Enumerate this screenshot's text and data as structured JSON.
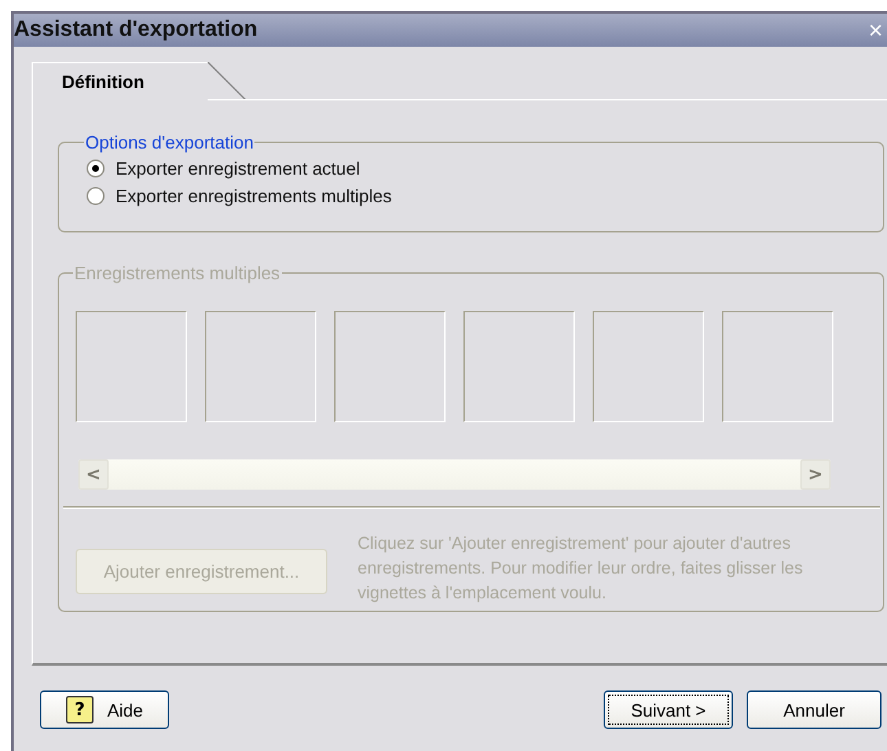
{
  "window": {
    "title": "Assistant d'exportation",
    "close": "×"
  },
  "tabs": [
    {
      "label": "Définition",
      "selected": true
    }
  ],
  "options_group": {
    "title": "Options d'exportation",
    "radios": [
      {
        "label": "Exporter enregistrement actuel",
        "selected": true
      },
      {
        "label": "Exporter enregistrements multiples",
        "selected": false
      }
    ]
  },
  "multiple_group": {
    "title": "Enregistrements multiples",
    "disabled": true,
    "add_button": "Ajouter enregistrement...",
    "help_text": "Cliquez sur 'Ajouter enregistrement' pour ajouter d'autres enregistrements. Pour modifier leur ordre, faites glisser les vignettes à l'emplacement voulu.",
    "scroll_left": "<",
    "scroll_right": ">"
  },
  "buttons": [
    {
      "kind": "help",
      "label": "Aide",
      "icon": "?"
    },
    {
      "kind": "next",
      "label": "Suivant >",
      "focused": true
    },
    {
      "kind": "cancel",
      "label": "Annuler",
      "focused": false
    }
  ]
}
